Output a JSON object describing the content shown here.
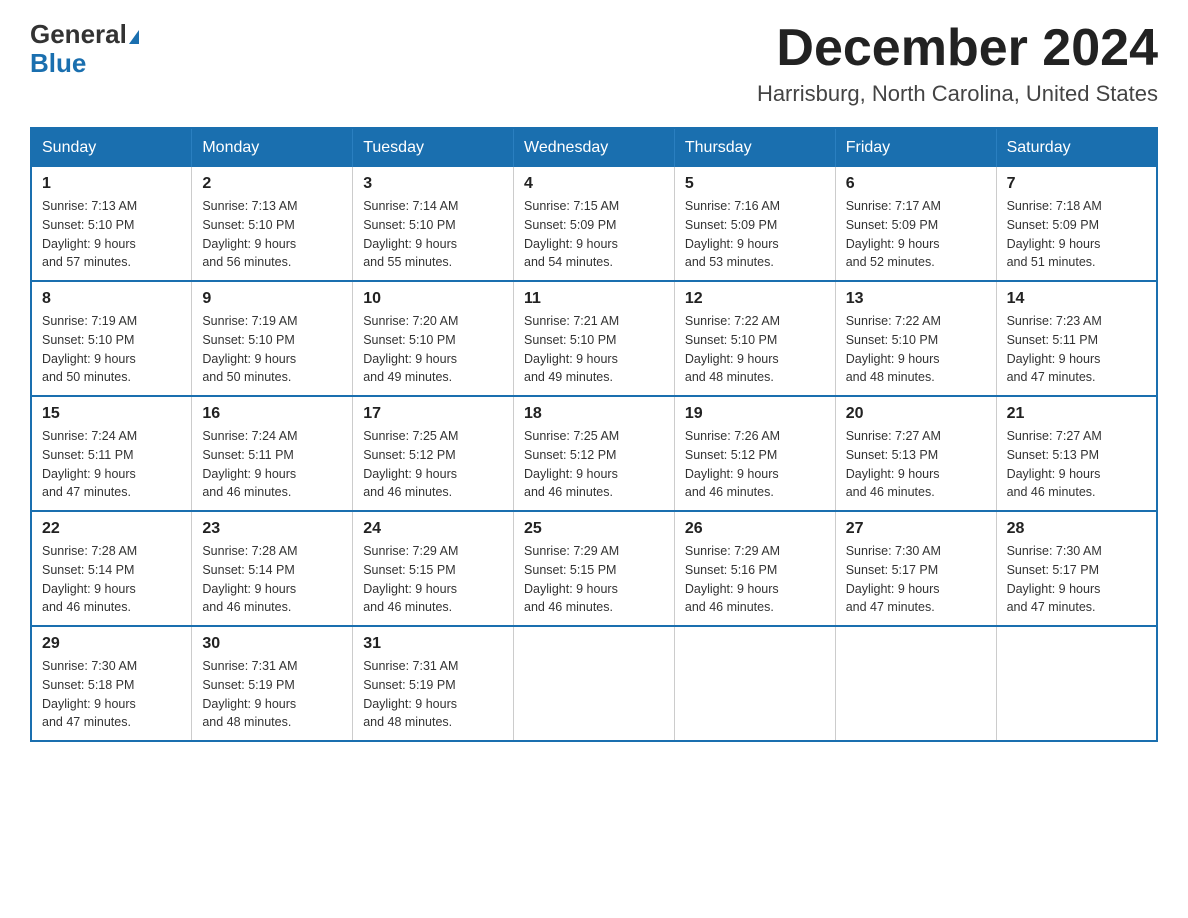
{
  "header": {
    "logo_general": "General",
    "logo_blue": "Blue",
    "month_title": "December 2024",
    "location": "Harrisburg, North Carolina, United States"
  },
  "weekdays": [
    "Sunday",
    "Monday",
    "Tuesday",
    "Wednesday",
    "Thursday",
    "Friday",
    "Saturday"
  ],
  "weeks": [
    [
      {
        "day": "1",
        "sunrise": "7:13 AM",
        "sunset": "5:10 PM",
        "daylight": "9 hours and 57 minutes."
      },
      {
        "day": "2",
        "sunrise": "7:13 AM",
        "sunset": "5:10 PM",
        "daylight": "9 hours and 56 minutes."
      },
      {
        "day": "3",
        "sunrise": "7:14 AM",
        "sunset": "5:10 PM",
        "daylight": "9 hours and 55 minutes."
      },
      {
        "day": "4",
        "sunrise": "7:15 AM",
        "sunset": "5:09 PM",
        "daylight": "9 hours and 54 minutes."
      },
      {
        "day": "5",
        "sunrise": "7:16 AM",
        "sunset": "5:09 PM",
        "daylight": "9 hours and 53 minutes."
      },
      {
        "day": "6",
        "sunrise": "7:17 AM",
        "sunset": "5:09 PM",
        "daylight": "9 hours and 52 minutes."
      },
      {
        "day": "7",
        "sunrise": "7:18 AM",
        "sunset": "5:09 PM",
        "daylight": "9 hours and 51 minutes."
      }
    ],
    [
      {
        "day": "8",
        "sunrise": "7:19 AM",
        "sunset": "5:10 PM",
        "daylight": "9 hours and 50 minutes."
      },
      {
        "day": "9",
        "sunrise": "7:19 AM",
        "sunset": "5:10 PM",
        "daylight": "9 hours and 50 minutes."
      },
      {
        "day": "10",
        "sunrise": "7:20 AM",
        "sunset": "5:10 PM",
        "daylight": "9 hours and 49 minutes."
      },
      {
        "day": "11",
        "sunrise": "7:21 AM",
        "sunset": "5:10 PM",
        "daylight": "9 hours and 49 minutes."
      },
      {
        "day": "12",
        "sunrise": "7:22 AM",
        "sunset": "5:10 PM",
        "daylight": "9 hours and 48 minutes."
      },
      {
        "day": "13",
        "sunrise": "7:22 AM",
        "sunset": "5:10 PM",
        "daylight": "9 hours and 48 minutes."
      },
      {
        "day": "14",
        "sunrise": "7:23 AM",
        "sunset": "5:11 PM",
        "daylight": "9 hours and 47 minutes."
      }
    ],
    [
      {
        "day": "15",
        "sunrise": "7:24 AM",
        "sunset": "5:11 PM",
        "daylight": "9 hours and 47 minutes."
      },
      {
        "day": "16",
        "sunrise": "7:24 AM",
        "sunset": "5:11 PM",
        "daylight": "9 hours and 46 minutes."
      },
      {
        "day": "17",
        "sunrise": "7:25 AM",
        "sunset": "5:12 PM",
        "daylight": "9 hours and 46 minutes."
      },
      {
        "day": "18",
        "sunrise": "7:25 AM",
        "sunset": "5:12 PM",
        "daylight": "9 hours and 46 minutes."
      },
      {
        "day": "19",
        "sunrise": "7:26 AM",
        "sunset": "5:12 PM",
        "daylight": "9 hours and 46 minutes."
      },
      {
        "day": "20",
        "sunrise": "7:27 AM",
        "sunset": "5:13 PM",
        "daylight": "9 hours and 46 minutes."
      },
      {
        "day": "21",
        "sunrise": "7:27 AM",
        "sunset": "5:13 PM",
        "daylight": "9 hours and 46 minutes."
      }
    ],
    [
      {
        "day": "22",
        "sunrise": "7:28 AM",
        "sunset": "5:14 PM",
        "daylight": "9 hours and 46 minutes."
      },
      {
        "day": "23",
        "sunrise": "7:28 AM",
        "sunset": "5:14 PM",
        "daylight": "9 hours and 46 minutes."
      },
      {
        "day": "24",
        "sunrise": "7:29 AM",
        "sunset": "5:15 PM",
        "daylight": "9 hours and 46 minutes."
      },
      {
        "day": "25",
        "sunrise": "7:29 AM",
        "sunset": "5:15 PM",
        "daylight": "9 hours and 46 minutes."
      },
      {
        "day": "26",
        "sunrise": "7:29 AM",
        "sunset": "5:16 PM",
        "daylight": "9 hours and 46 minutes."
      },
      {
        "day": "27",
        "sunrise": "7:30 AM",
        "sunset": "5:17 PM",
        "daylight": "9 hours and 47 minutes."
      },
      {
        "day": "28",
        "sunrise": "7:30 AM",
        "sunset": "5:17 PM",
        "daylight": "9 hours and 47 minutes."
      }
    ],
    [
      {
        "day": "29",
        "sunrise": "7:30 AM",
        "sunset": "5:18 PM",
        "daylight": "9 hours and 47 minutes."
      },
      {
        "day": "30",
        "sunrise": "7:31 AM",
        "sunset": "5:19 PM",
        "daylight": "9 hours and 48 minutes."
      },
      {
        "day": "31",
        "sunrise": "7:31 AM",
        "sunset": "5:19 PM",
        "daylight": "9 hours and 48 minutes."
      },
      null,
      null,
      null,
      null
    ]
  ]
}
